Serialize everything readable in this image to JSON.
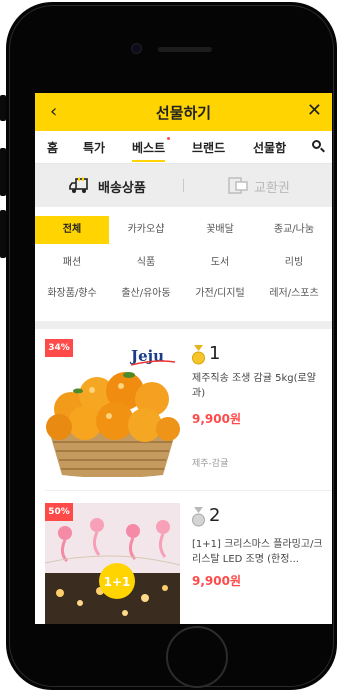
{
  "header": {
    "title": "선물하기",
    "back_icon": "chevron-left-icon",
    "close_icon": "close-icon"
  },
  "tabs": [
    {
      "label": "홈",
      "active": false
    },
    {
      "label": "특가",
      "active": false
    },
    {
      "label": "베스트",
      "active": true,
      "new_dot": true
    },
    {
      "label": "브랜드",
      "active": false
    },
    {
      "label": "선물함",
      "active": false
    }
  ],
  "segments": [
    {
      "label": "배송상품",
      "icon": "truck-icon",
      "active": true
    },
    {
      "label": "교환권",
      "icon": "coupon-icon",
      "active": false
    }
  ],
  "categories": [
    [
      "전체",
      "카카오샵",
      "꽃배달",
      "종교/나눔"
    ],
    [
      "패션",
      "식품",
      "도서",
      "리빙"
    ],
    [
      "화장품/향수",
      "출산/유아동",
      "가전/디지털",
      "레저/스포츠"
    ]
  ],
  "active_category": "전체",
  "products": [
    {
      "rank": "1",
      "discount": "34%",
      "image_text": "Jeju",
      "name": "제주직송 조생 감귤 5kg(로얄과)",
      "price": "9,900원",
      "tag": "제주-감귤",
      "medal": "gold"
    },
    {
      "rank": "2",
      "discount": "50%",
      "image_text": "1+1",
      "name": "[1+1] 크리스마스 플라밍고/크리스탈 LED 조명 (한정...",
      "price": "9,900원",
      "tag": "",
      "medal": "silver"
    }
  ],
  "colors": {
    "accent": "#ffd400",
    "price": "#ff4a4a",
    "badge": "#ff4a4a"
  }
}
